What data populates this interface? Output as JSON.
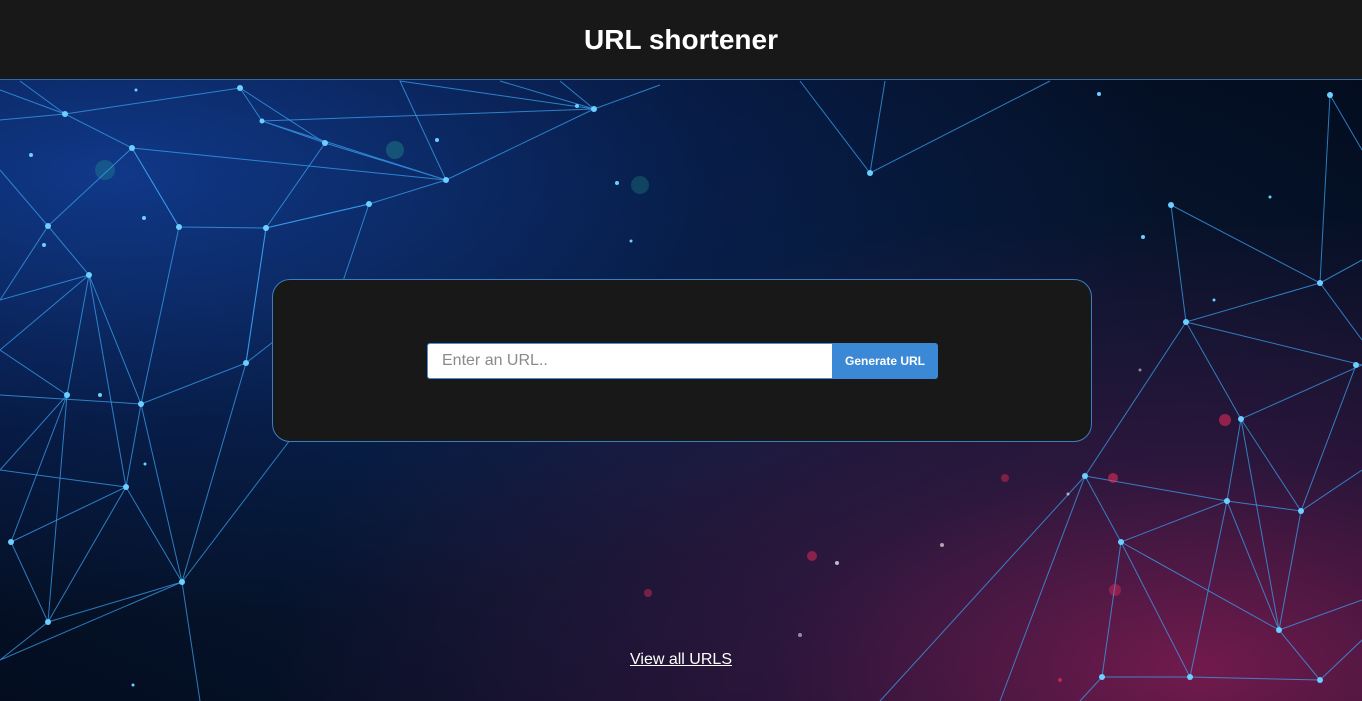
{
  "header": {
    "title": "URL shortener"
  },
  "form": {
    "url_placeholder": "Enter an URL..",
    "url_value": "",
    "generate_label": "Generate URL"
  },
  "footer": {
    "view_all_label": "View all URLS"
  },
  "colors": {
    "header_bg": "#181818",
    "card_bg": "#181818",
    "accent": "#3b88d6",
    "border": "#3b7dbf",
    "network_line": "#3aa0f0",
    "text": "#ffffff"
  }
}
